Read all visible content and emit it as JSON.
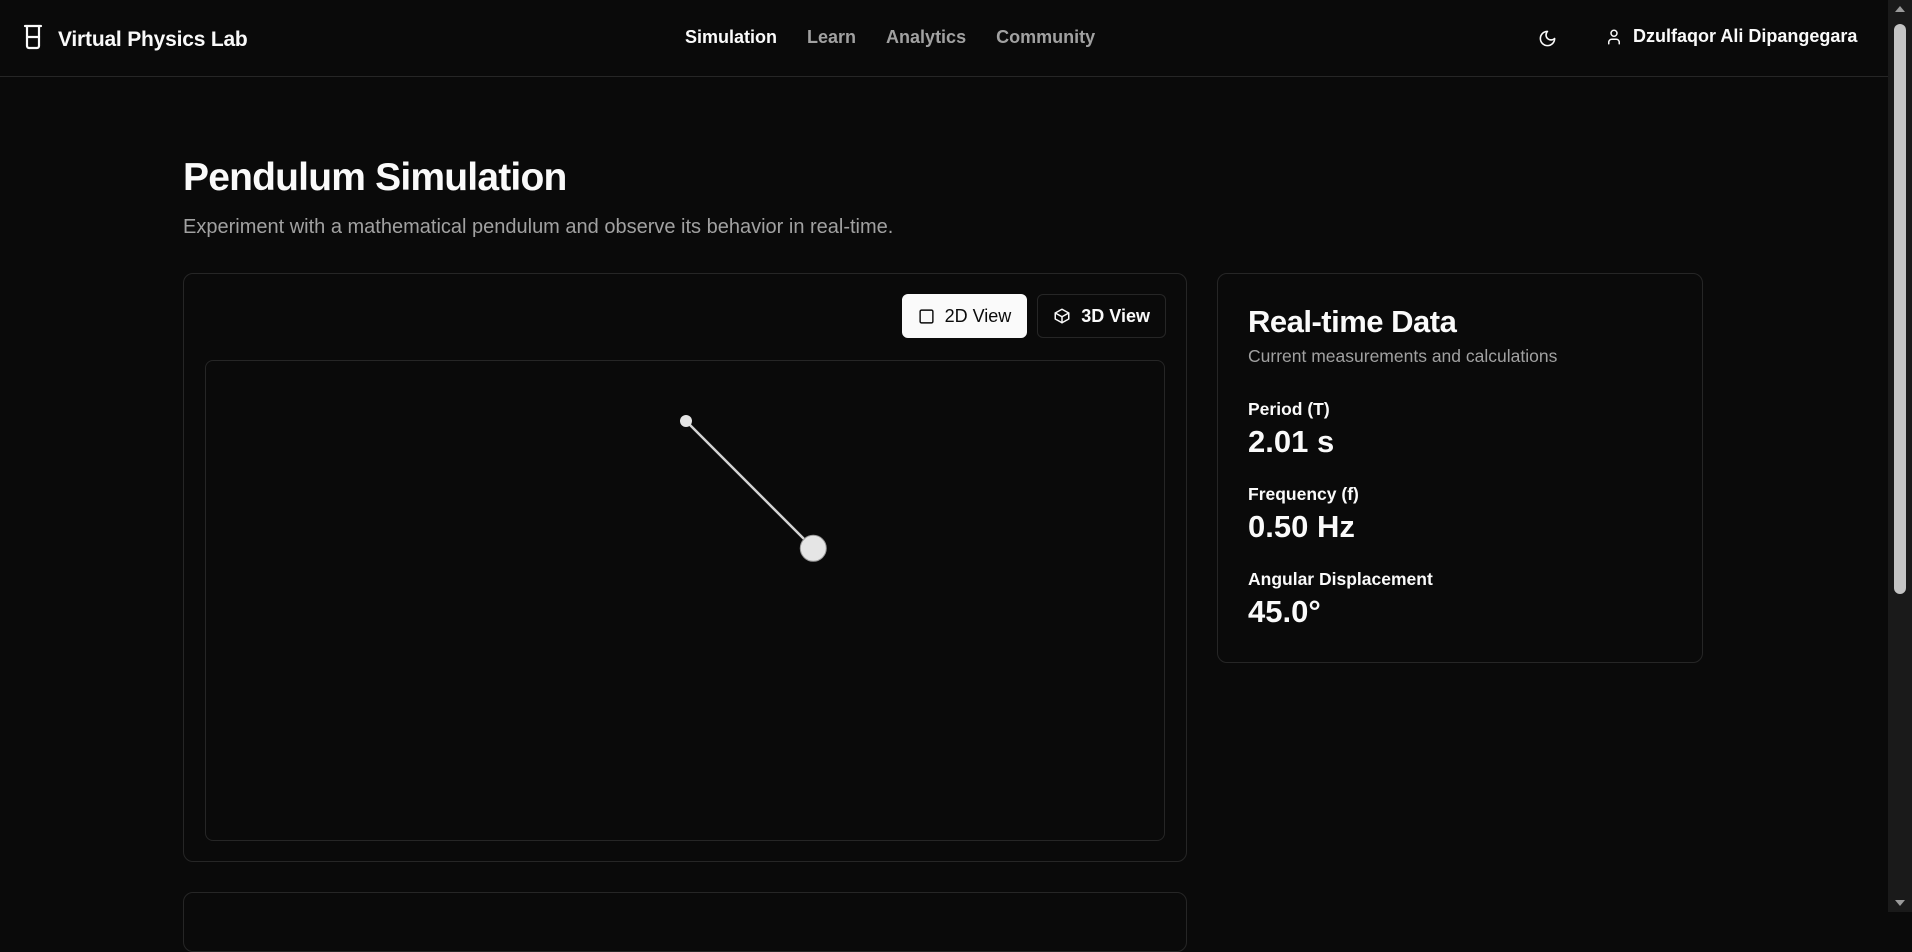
{
  "app": {
    "title": "Virtual Physics Lab"
  },
  "nav": {
    "items": [
      {
        "label": "Simulation",
        "active": true
      },
      {
        "label": "Learn",
        "active": false
      },
      {
        "label": "Analytics",
        "active": false
      },
      {
        "label": "Community",
        "active": false
      }
    ]
  },
  "user": {
    "name": "Dzulfaqor Ali Dipangegara"
  },
  "icons": {
    "brand": "beaker-icon",
    "theme": "moon-icon",
    "user": "user-icon",
    "view2d": "square-icon",
    "view3d": "cube-icon"
  },
  "page": {
    "title": "Pendulum Simulation",
    "subtitle": "Experiment with a mathematical pendulum and observe its behavior in real-time."
  },
  "views": {
    "view_2d": "2D View",
    "view_3d": "3D View",
    "selected": "2D View"
  },
  "pendulum": {
    "angle_deg": 45.0
  },
  "realtime": {
    "title": "Real-time Data",
    "subtitle": "Current measurements and calculations",
    "metrics": [
      {
        "label": "Period (T)",
        "value": "2.01 s"
      },
      {
        "label": "Frequency (f)",
        "value": "0.50 Hz"
      },
      {
        "label": "Angular Displacement",
        "value": "45.0°"
      }
    ]
  },
  "colors": {
    "background": "#0a0a0a",
    "border": "#262626",
    "muted": "#a1a1a1",
    "foreground": "#fafafa"
  }
}
